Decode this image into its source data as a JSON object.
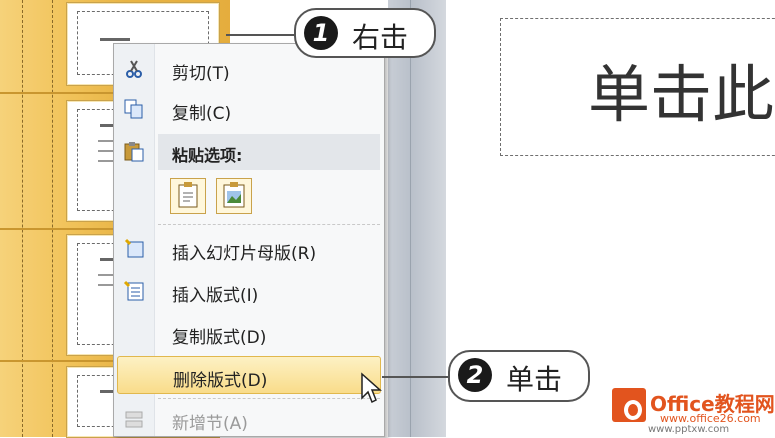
{
  "slide": {
    "title_placeholder": "单击此"
  },
  "context_menu": {
    "items": [
      {
        "label": "剪切(T)",
        "icon": "scissors-icon",
        "enabled": true
      },
      {
        "label": "复制(C)",
        "icon": "copy-icon",
        "enabled": true
      },
      {
        "label": "粘贴选项:",
        "icon": "paste-icon",
        "enabled": true
      },
      {
        "label": "插入幻灯片母版(R)",
        "icon": "insert-master-icon",
        "enabled": true
      },
      {
        "label": "插入版式(I)",
        "icon": "insert-layout-icon",
        "enabled": true
      },
      {
        "label": "复制版式(D)",
        "icon": "",
        "enabled": true
      },
      {
        "label": "删除版式(D)",
        "icon": "",
        "enabled": true,
        "highlighted": true
      },
      {
        "label": "新增节(A)",
        "icon": "new-section-icon",
        "enabled": false
      }
    ],
    "paste_options": [
      "keep-text-only-icon",
      "picture-icon"
    ]
  },
  "callouts": [
    {
      "number": "1",
      "text": "右击"
    },
    {
      "number": "2",
      "text": "单击"
    }
  ],
  "watermark": {
    "brand": "Office教程网",
    "site": "www.office26.com",
    "url": "www.pptxw.com"
  },
  "colors": {
    "accent": "#e2541e",
    "pane": "#f1c35a",
    "highlight": "#f9dc8a"
  }
}
